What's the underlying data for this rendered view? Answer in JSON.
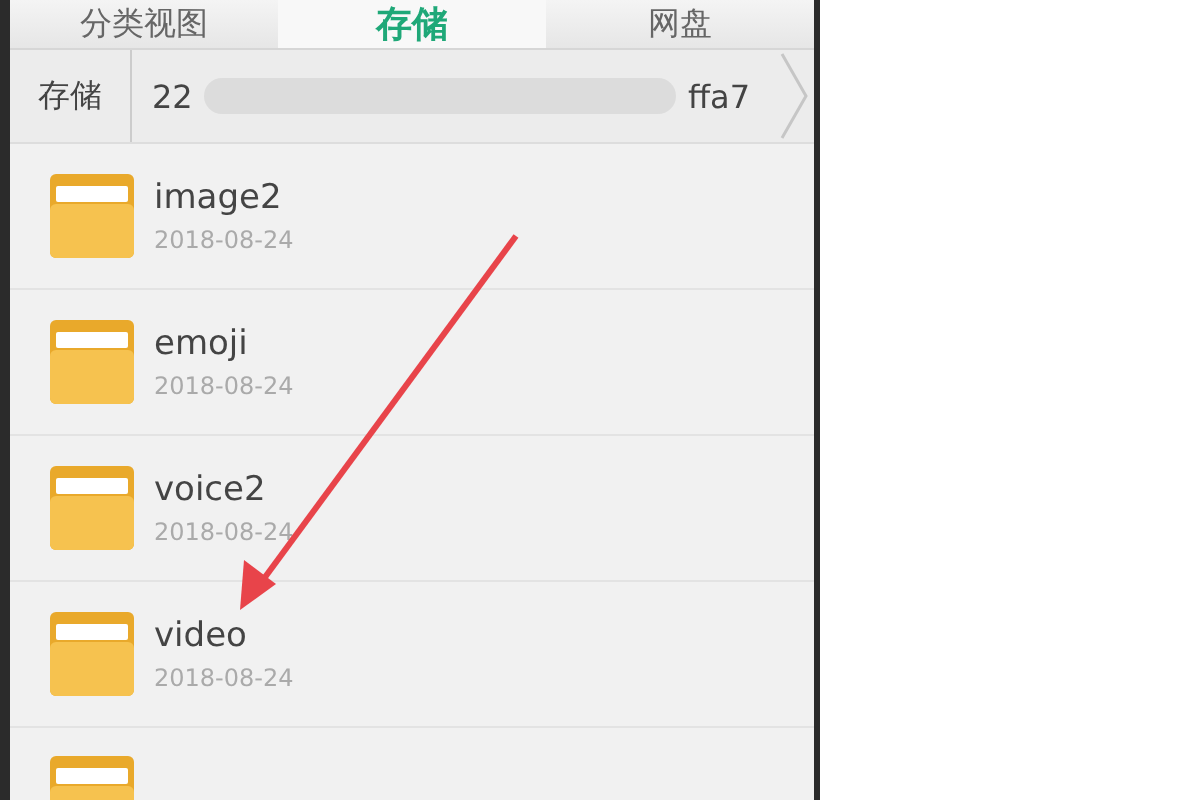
{
  "tabs": [
    {
      "label": "分类视图",
      "selected": false
    },
    {
      "label": "存储",
      "selected": true
    },
    {
      "label": "网盘",
      "selected": false
    }
  ],
  "breadcrumb": [
    {
      "label": "存储",
      "redacted": false
    },
    {
      "label": "22",
      "tail": "ffa7",
      "redacted": true
    }
  ],
  "files": [
    {
      "kind": "folder",
      "name": "image2",
      "date": "2018-08-24"
    },
    {
      "kind": "folder",
      "name": "emoji",
      "date": "2018-08-24"
    },
    {
      "kind": "folder",
      "name": "voice2",
      "date": "2018-08-24"
    },
    {
      "kind": "folder",
      "name": "video",
      "date": "2018-08-24"
    },
    {
      "kind": "cut-off"
    }
  ]
}
